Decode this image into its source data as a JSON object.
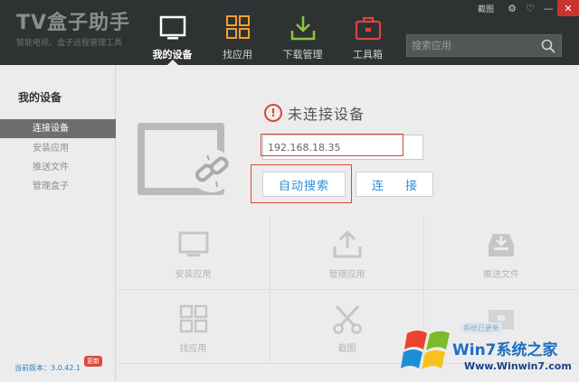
{
  "app": {
    "title": "TV盒子助手",
    "subtitle": "智能电视，盒子远程管理工具"
  },
  "window_controls": {
    "screenshot_label": "截图"
  },
  "nav": [
    {
      "label": "我的设备",
      "icon": "monitor-icon",
      "active": true
    },
    {
      "label": "找应用",
      "icon": "grid-icon",
      "active": false
    },
    {
      "label": "下载管理",
      "icon": "download-icon",
      "active": false
    },
    {
      "label": "工具箱",
      "icon": "toolbox-icon",
      "active": false
    }
  ],
  "search": {
    "placeholder": "搜索应用",
    "icon": "search-icon"
  },
  "sidebar": {
    "title": "我的设备",
    "items": [
      {
        "label": "连接设备",
        "active": true
      },
      {
        "label": "安装应用",
        "active": false
      },
      {
        "label": "推送文件",
        "active": false
      },
      {
        "label": "管理盒子",
        "active": false
      }
    ],
    "version": "当前版本：3.0.42.1",
    "badge": "更新"
  },
  "main": {
    "status_text": "未连接设备",
    "ip_value": "192.168.18.35",
    "auto_search_label": "自动搜索",
    "connect_label": "连 接"
  },
  "tiles": [
    {
      "label": "安装应用",
      "icon": "install-app-icon"
    },
    {
      "label": "管理应用",
      "icon": "upload-icon"
    },
    {
      "label": "推送文件",
      "icon": "inbox-icon"
    },
    {
      "label": "找应用",
      "icon": "grid-icon"
    },
    {
      "label": "截图",
      "icon": "scissors-icon"
    },
    {
      "label": "",
      "icon": "box-icon"
    }
  ],
  "watermark": {
    "brand": "Win7系统之家",
    "url": "Www.Winwin7.com",
    "tag": "系统已更新"
  },
  "colors": {
    "topbar": "#2f3233",
    "accent_blue": "#2a8fd8",
    "warn_red": "#d8473a",
    "download_green": "#8dc63f",
    "grid_orange": "#f0a030"
  }
}
